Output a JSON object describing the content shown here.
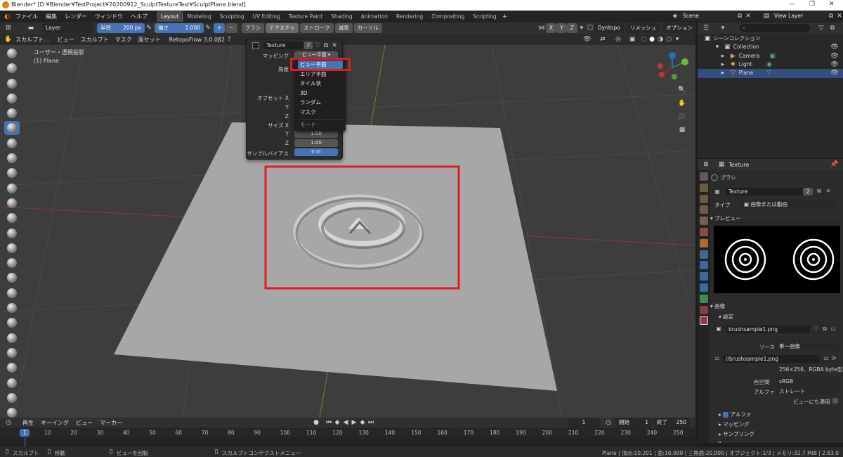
{
  "window": {
    "title": "Blender* [D:¥Blender¥TestProject¥20200912_SculptTextureTest¥SculptPlane.blend]"
  },
  "menu": [
    "ファイル",
    "編集",
    "レンダー",
    "ウィンドウ",
    "ヘルプ"
  ],
  "workspaces": [
    "Layout",
    "Modeling",
    "Sculpting",
    "UV Editing",
    "Texture Paint",
    "Shading",
    "Animation",
    "Rendering",
    "Compositing",
    "Scripting"
  ],
  "active_workspace": "Layout",
  "scene": "Scene",
  "view_layer": "View Layer",
  "tool_header": {
    "layer": "Layer",
    "radius_label": "半径",
    "radius_value": "200 px",
    "strength_label": "強さ",
    "strength_value": "1.000",
    "menus": [
      "ブラシ",
      "テクスチャ",
      "ストローク",
      "減衰",
      "カーソル"
    ],
    "axes": [
      "X",
      "Y",
      "Z"
    ],
    "dyntopo": "Dyntopo",
    "remesh": "リメッシュ",
    "options": "オプション"
  },
  "editor_header": {
    "mode": "スカルプト...",
    "items": [
      "ビュー",
      "スカルプト",
      "マスク",
      "面セット"
    ],
    "addon": "RetopoFlow 3.0.0β2"
  },
  "viewport": {
    "view_name": "ユーザー・透視投影",
    "object_name": "(1) Plane",
    "gizmo": {
      "x": "X",
      "y": "Y",
      "z": "Z"
    }
  },
  "texture_popup": {
    "texture_name": "Texture",
    "users": "2",
    "mapping_label": "マッピング",
    "mapping_value": "ビュー平面",
    "angle_label": "角度",
    "offset_label": "オフセット X",
    "y_label": "Y",
    "z_label": "Z",
    "size_label": "サイズ X",
    "size_y": "1.00",
    "size_z": "1.00",
    "sample_bias_label": "サンプルバイアス",
    "sample_bias_value": "0 m",
    "dropdown": [
      "ビュー平面",
      "エリア平面",
      "タイル状",
      "3D",
      "ランダム",
      "マスク"
    ],
    "dropdown_footer": "モード"
  },
  "outliner": {
    "root": "シーンコレクション",
    "items": [
      {
        "name": "Collection"
      },
      {
        "name": "Camera"
      },
      {
        "name": "Light"
      },
      {
        "name": "Plane"
      }
    ],
    "selected": "Plane"
  },
  "properties": {
    "title": "Texture",
    "brush_label": "ブラシ",
    "texture_name": "Texture",
    "users": "2",
    "type_label": "タイプ",
    "type_value": "画像または動画",
    "preview_label": "プレビュー",
    "image_section": "画像",
    "settings_label": "設定",
    "image_name": "brushsample1.png",
    "source_label": "ソース",
    "source_value": "単一画像",
    "filepath": "//brushsample1.png",
    "resolution": "256×256、RGBA byte型",
    "colorspace_label": "色空間",
    "colorspace_value": "sRGB",
    "alpha_label": "アルファ",
    "alpha_value": "ストレート",
    "view_as_render": "ビューにも適用",
    "sub_alpha": "アルファ",
    "sub_mapping": "マッピング",
    "sub_sampling": "サンプリング",
    "sub_color": "色"
  },
  "timeline": {
    "menus": [
      "再生",
      "キーイング",
      "ビュー",
      "マーカー"
    ],
    "current_frame": "1",
    "start_label": "開始",
    "start": "1",
    "end_label": "終了",
    "end": "250",
    "ticks": [
      "1",
      "10",
      "20",
      "30",
      "40",
      "50",
      "60",
      "70",
      "80",
      "90",
      "100",
      "110",
      "120",
      "130",
      "140",
      "150",
      "160",
      "170",
      "180",
      "190",
      "200",
      "210",
      "220",
      "230",
      "240",
      "250"
    ]
  },
  "status": {
    "left1": "スカルプト",
    "left2": "移動",
    "left3": "ビューを回転",
    "left4": "スカルプトコンテクストメニュー",
    "right": "Plane | 頂点:10,201 | 面:10,000 | 三角面:20,000 | オブジェクト:1/3 | メモリ:32.7 MiB | 2.83.0"
  },
  "colors": {
    "accent": "#4772b3",
    "highlight_box": "#e01b24"
  }
}
